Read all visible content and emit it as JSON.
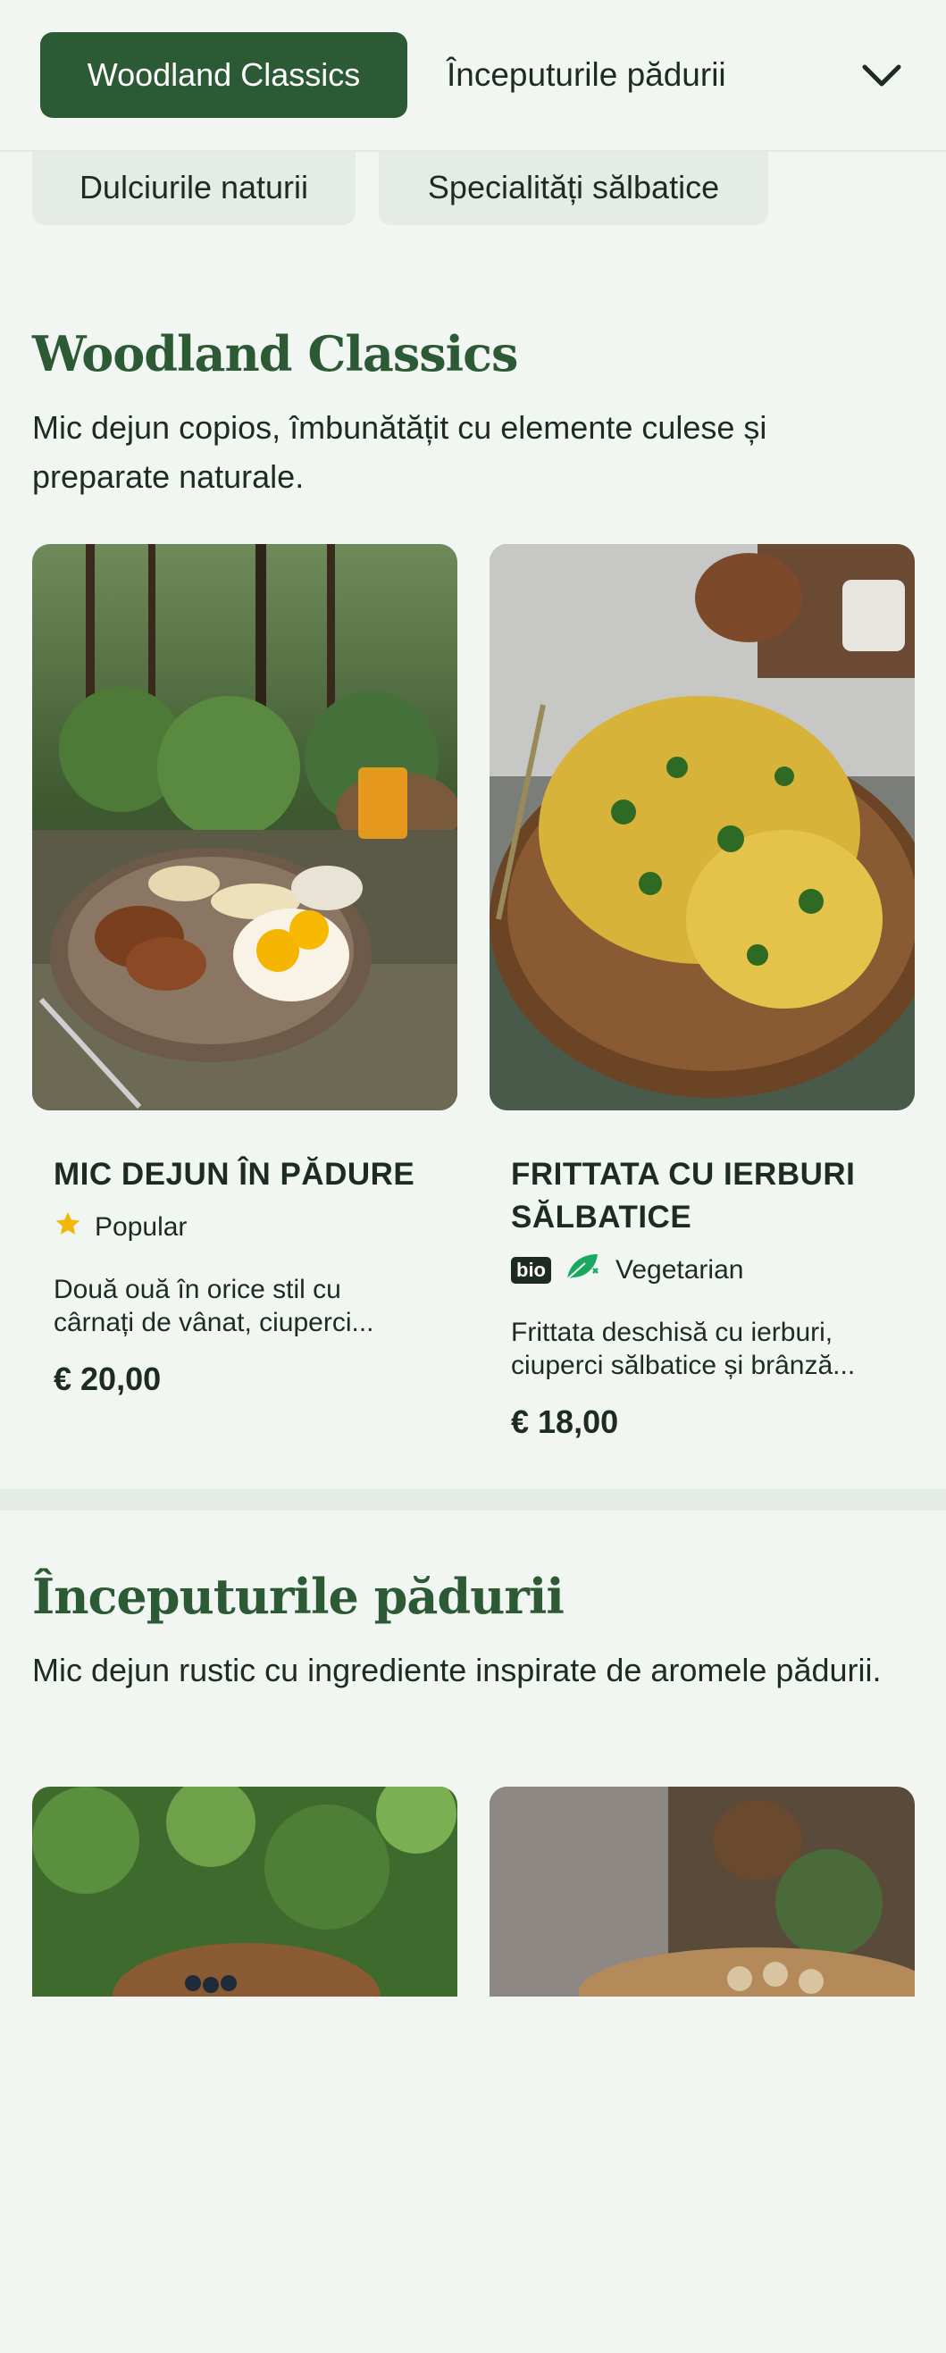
{
  "nav": {
    "active_tab": "Woodland Classics",
    "tabs": [
      "Începuturile pădurii",
      "Dulciurile naturii",
      "Specialități sălbatice"
    ],
    "expand_icon": "chevron-down-icon"
  },
  "sections": [
    {
      "title": "Woodland Classics",
      "description": "Mic dejun copios, îmbunătățit cu elemente culese și preparate naturale.",
      "items": [
        {
          "name": "MIC DEJUN ÎN PĂDURE",
          "tag_icon": "star-icon",
          "tag": "Popular",
          "description": "Două ouă în orice stil cu cârnați de vânat, ciuperci...",
          "price": "€ 20,00"
        },
        {
          "name": "FRITTATA CU IERBURI SĂLBATICE",
          "badge": "bio",
          "tag_icon": "vegetarian-leaf-icon",
          "tag": "Vegetarian",
          "description": "Frittata deschisă cu ierburi, ciuperci sălbatice și brânză...",
          "price": "€ 18,00"
        }
      ]
    },
    {
      "title": "Începuturile pădurii",
      "description": "Mic dejun rustic cu ingrediente inspirate de aromele pădurii."
    }
  ],
  "colors": {
    "brand_green": "#2c5a35",
    "background": "#f2f6f2",
    "pill_soft": "#e5ece6",
    "star": "#f2b705",
    "veg_leaf": "#1aa860"
  }
}
